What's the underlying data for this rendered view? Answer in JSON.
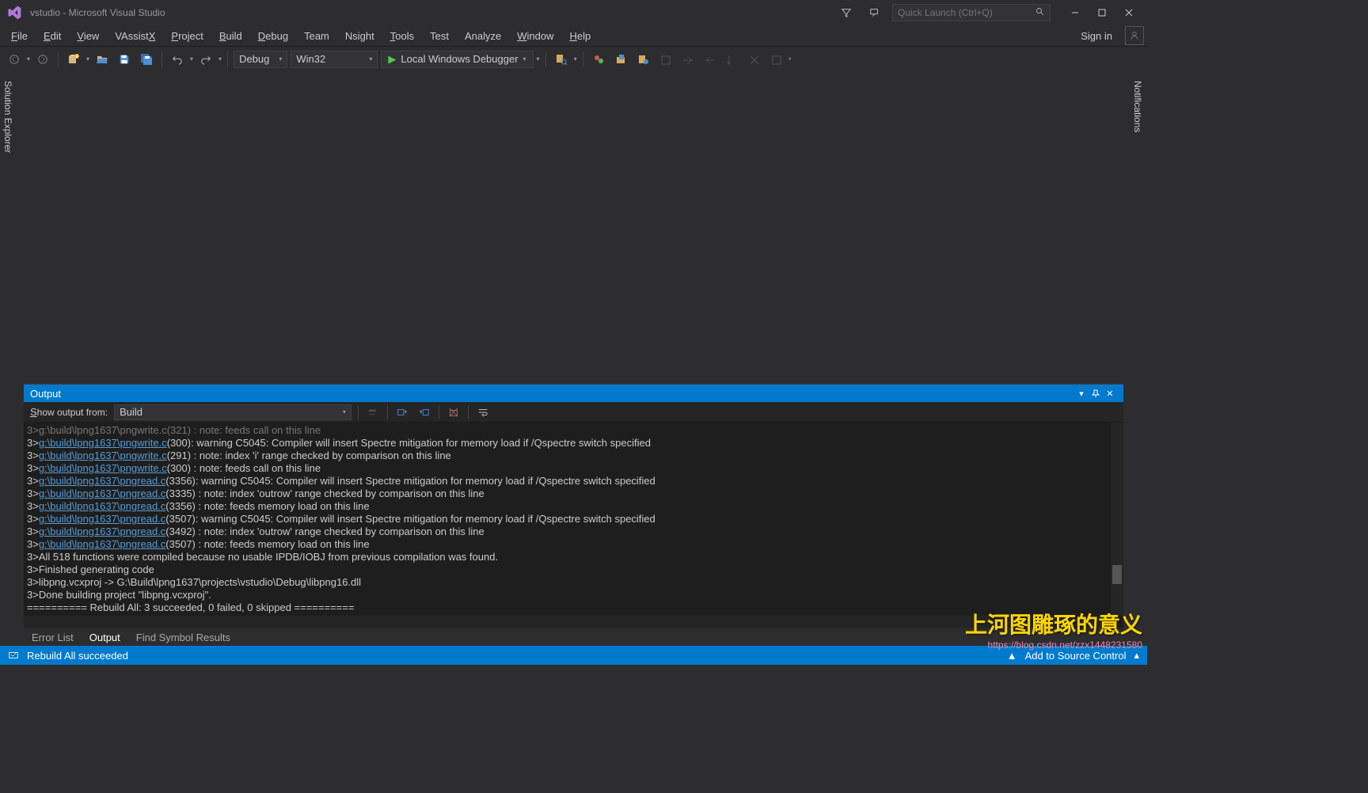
{
  "title": "vstudio - Microsoft Visual Studio",
  "quick_launch_placeholder": "Quick Launch (Ctrl+Q)",
  "menus": [
    "File",
    "Edit",
    "View",
    "VAssistX",
    "Project",
    "Build",
    "Debug",
    "Team",
    "Nsight",
    "Tools",
    "Test",
    "Analyze",
    "Window",
    "Help"
  ],
  "menu_underlines": [
    "F",
    "E",
    "V",
    "X",
    "P",
    "B",
    "D",
    "",
    "",
    "T",
    "",
    "",
    "W",
    "H"
  ],
  "sign_in": "Sign in",
  "config": "Debug",
  "platform": "Win32",
  "debugger_label": "Local Windows Debugger",
  "side_left": "Solution Explorer",
  "side_right": "Notifications",
  "output": {
    "title": "Output",
    "show_from_label": "Show output from:",
    "source": "Build",
    "lines": [
      {
        "n": "3>",
        "fp": "g:\\build\\lpng1637\\pngwrite.c",
        "rest": "(300): warning C5045: Compiler will insert Spectre mitigation for memory load if /Qspectre switch specified"
      },
      {
        "n": "3>",
        "fp": "g:\\build\\lpng1637\\pngwrite.c",
        "rest": "(291) : note: index 'i' range checked by comparison on this line"
      },
      {
        "n": "3>",
        "fp": "g:\\build\\lpng1637\\pngwrite.c",
        "rest": "(300) : note: feeds call on this line"
      },
      {
        "n": "3>",
        "fp": "g:\\build\\lpng1637\\pngread.c",
        "rest": "(3356): warning C5045: Compiler will insert Spectre mitigation for memory load if /Qspectre switch specified"
      },
      {
        "n": "3>",
        "fp": "g:\\build\\lpng1637\\pngread.c",
        "rest": "(3335) : note: index 'outrow' range checked by comparison on this line"
      },
      {
        "n": "3>",
        "fp": "g:\\build\\lpng1637\\pngread.c",
        "rest": "(3356) : note: feeds memory load on this line"
      },
      {
        "n": "3>",
        "fp": "g:\\build\\lpng1637\\pngread.c",
        "rest": "(3507): warning C5045: Compiler will insert Spectre mitigation for memory load if /Qspectre switch specified"
      },
      {
        "n": "3>",
        "fp": "g:\\build\\lpng1637\\pngread.c",
        "rest": "(3492) : note: index 'outrow' range checked by comparison on this line"
      },
      {
        "n": "3>",
        "fp": "g:\\build\\lpng1637\\pngread.c",
        "rest": "(3507) : note: feeds memory load on this line"
      },
      {
        "n": "3>",
        "fp": "",
        "rest": "All 518 functions were compiled because no usable IPDB/IOBJ from previous compilation was found."
      },
      {
        "n": "3>",
        "fp": "",
        "rest": "Finished generating code"
      },
      {
        "n": "3>",
        "fp": "",
        "rest": "libpng.vcxproj -> G:\\Build\\lpng1637\\projects\\vstudio\\Debug\\libpng16.dll"
      },
      {
        "n": "3>",
        "fp": "",
        "rest": "Done building project \"libpng.vcxproj\"."
      },
      {
        "n": "",
        "fp": "",
        "rest": "========== Rebuild All: 3 succeeded, 0 failed, 0 skipped =========="
      }
    ]
  },
  "bottom_tabs": [
    "Error List",
    "Output",
    "Find Symbol Results"
  ],
  "status": {
    "msg": "Rebuild All succeeded",
    "source": "Add to Source Control"
  },
  "watermark": {
    "cn": "上河图雕琢的意义",
    "url": "https://blog.csdn.net/zzx1448231580"
  }
}
